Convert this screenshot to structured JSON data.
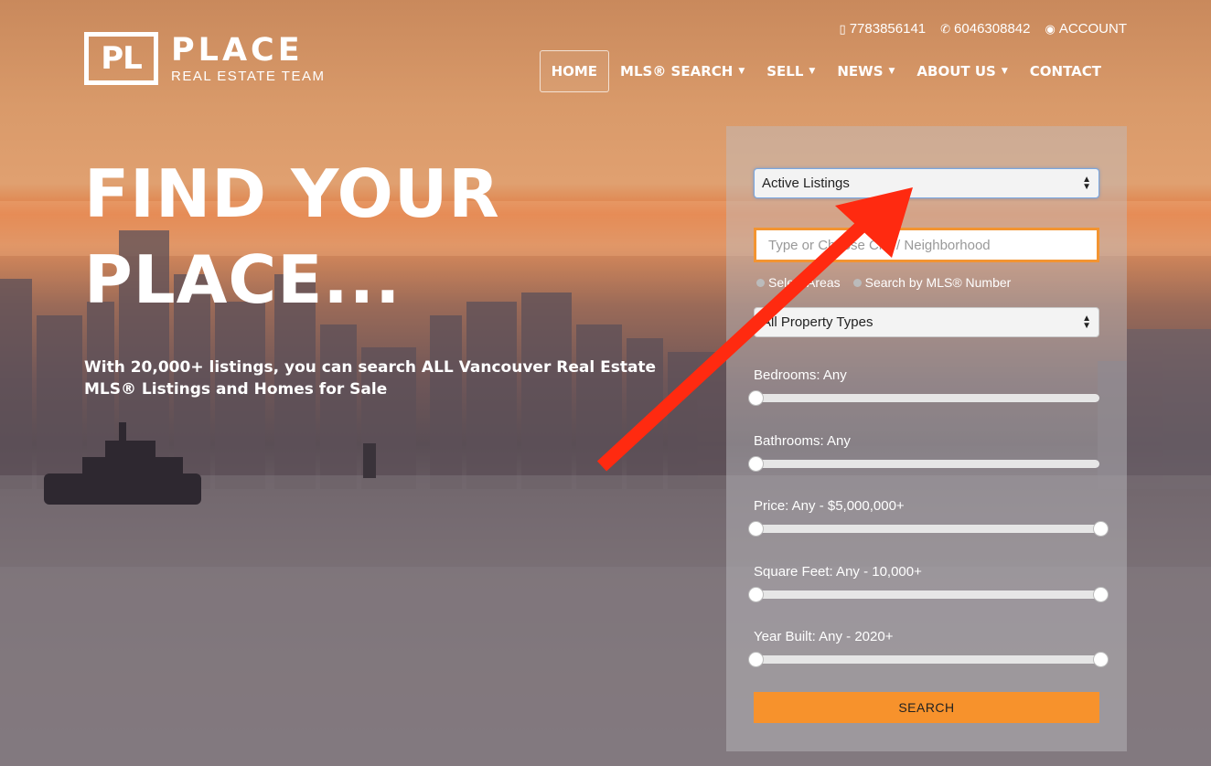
{
  "brand": {
    "mark": "PL",
    "name": "PLACE",
    "subtitle": "REAL ESTATE TEAM"
  },
  "topbar": {
    "phone_mobile": "7783856141",
    "phone": "6046308842",
    "account": "ACCOUNT"
  },
  "nav": {
    "home": "HOME",
    "mls_search": "MLS® SEARCH",
    "sell": "SELL",
    "news": "NEWS",
    "about": "ABOUT US",
    "contact": "CONTACT"
  },
  "hero": {
    "headline_line1": "FIND YOUR",
    "headline_line2": "PLACE...",
    "tagline": "With 20,000+ listings, you can search ALL Vancouver Real Estate MLS® Listings and Homes for Sale"
  },
  "search": {
    "listing_status": "Active Listings",
    "location_placeholder": "Type or Choose City / Neighborhood",
    "select_areas": "Select Areas",
    "search_by_mls": "Search by MLS® Number",
    "property_types": "All Property Types",
    "bedrooms": "Bedrooms: Any",
    "bathrooms": "Bathrooms: Any",
    "price": "Price:  Any - $5,000,000+",
    "square_feet": "Square Feet:  Any - 10,000+",
    "year_built": "Year Built:  Any - 2020+",
    "button": "SEARCH"
  },
  "colors": {
    "accent": "#f7922c",
    "arrow": "#ff2a10"
  }
}
